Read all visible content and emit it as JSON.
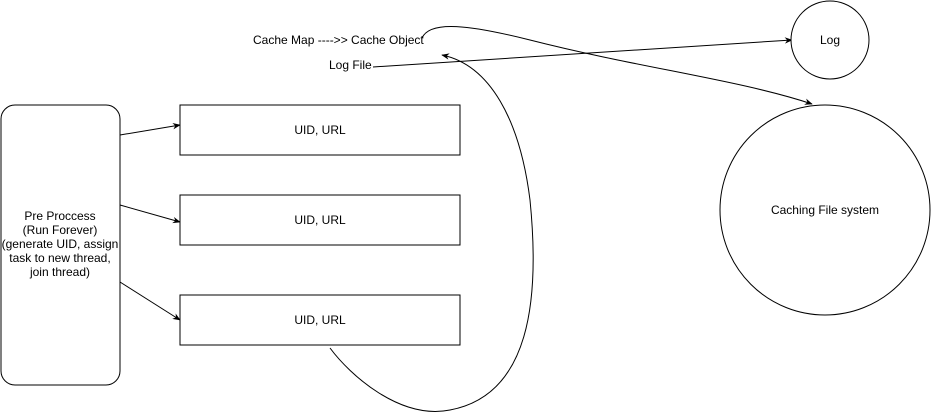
{
  "diagram": {
    "cache_map_label": "Cache Map ---->> Cache Object",
    "log_file_label": "Log File",
    "log_node_label": "Log",
    "caching_fs_label": "Caching File system",
    "preprocess_lines": [
      "Pre Proccess",
      "(Run Forever)",
      "(generate UID, assign",
      "task to new thread,",
      "join thread)"
    ],
    "thread_boxes": [
      {
        "label": "UID, URL"
      },
      {
        "label": "UID, URL"
      },
      {
        "label": "UID, URL"
      }
    ]
  }
}
